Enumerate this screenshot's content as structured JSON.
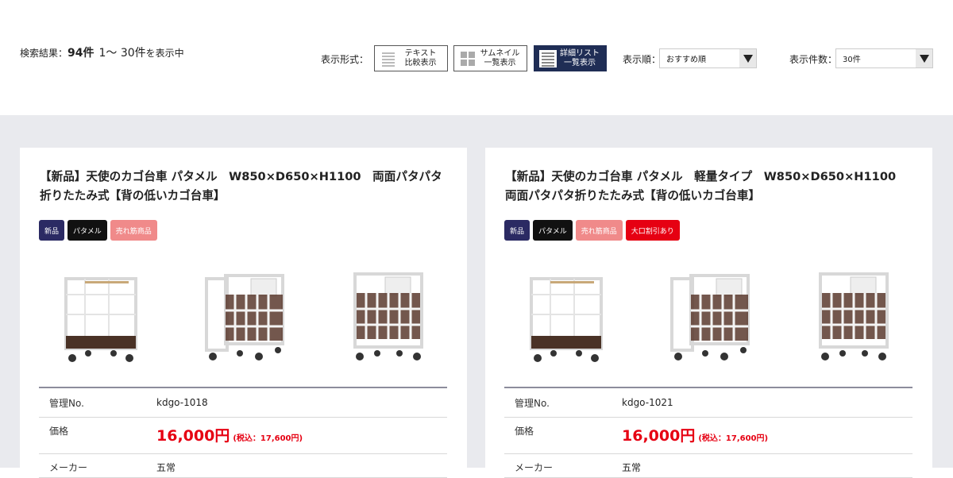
{
  "toolbar": {
    "result_prefix": "検索結果：",
    "result_count": "94件",
    "result_range": "1〜 30件",
    "result_suffix": "を表示中",
    "format_label": "表示形式：",
    "view_text_label": "テキスト\n比較表示",
    "view_thumb_label": "サムネイル\n一覧表示",
    "view_list_label": "詳細リスト\n一覧表示",
    "sort_label": "表示順：",
    "sort_value": "おすすめ順",
    "count_label": "表示件数：",
    "count_value": "30件"
  },
  "products": [
    {
      "title": "【新品】天使のカゴ台車 パタメル　W850×D650×H1100　両面パタパタ折りたたみ式【背の低いカゴ台車】",
      "tags": [
        "新品",
        "パタメル",
        "売れ筋商品"
      ],
      "spec_id_label": "管理No.",
      "spec_id": "kdgo-1018",
      "spec_price_label": "価格",
      "price": "16,000円",
      "tax": "(税込：17,600円)",
      "spec_maker_label": "メーカー",
      "maker": "五常"
    },
    {
      "title": "【新品】天使のカゴ台車 パタメル　軽量タイプ　W850×D650×H1100　両面パタパタ折りたたみ式【背の低いカゴ台車】",
      "tags": [
        "新品",
        "パタメル",
        "売れ筋商品",
        "大口割引あり"
      ],
      "spec_id_label": "管理No.",
      "spec_id": "kdgo-1021",
      "spec_price_label": "価格",
      "price": "16,000円",
      "tax": "(税込：17,600円)",
      "spec_maker_label": "メーカー",
      "maker": "五常"
    }
  ],
  "colors": {
    "accent_navy": "#1f2d55",
    "price_red": "#e60012",
    "tag_new": "#2b2a63",
    "tag_best": "#f08a8a",
    "tag_bulk": "#e60012"
  }
}
